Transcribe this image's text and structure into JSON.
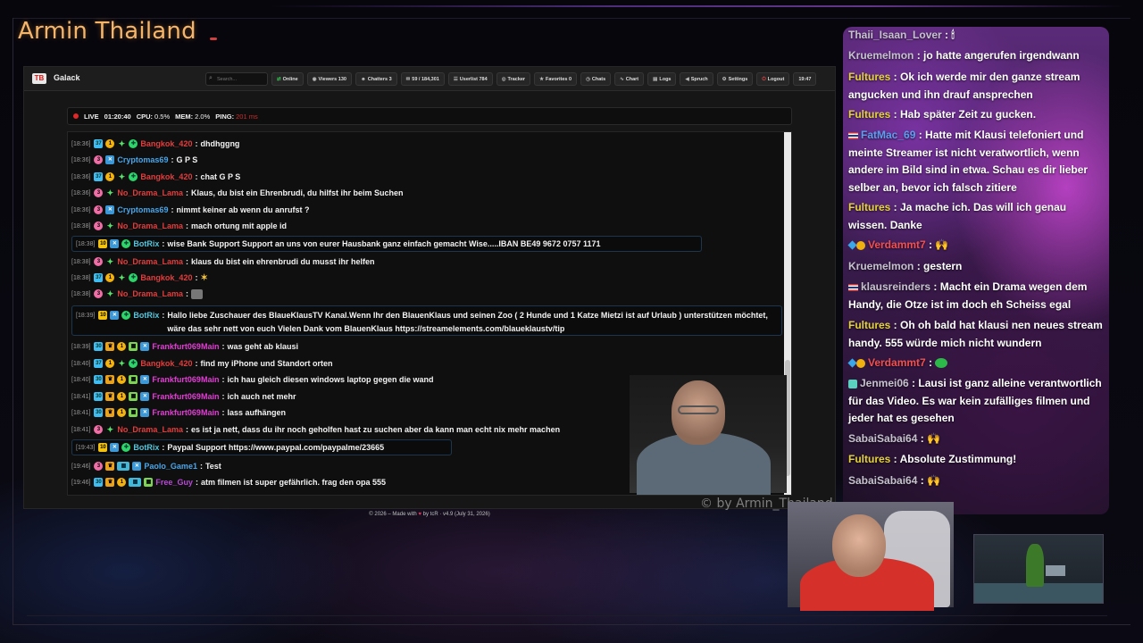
{
  "overlay": {
    "stream_title": "Armin Thailand",
    "watermark": "© by Armin_Thailand"
  },
  "dashboard": {
    "brand": "Galack",
    "logo_text": "TB",
    "search_placeholder": "Search...",
    "nav": [
      {
        "icon": "online-icon",
        "label": "Online"
      },
      {
        "icon": "eye-icon",
        "label": "Viewers 130"
      },
      {
        "icon": "users-icon",
        "label": "Chatters 3"
      },
      {
        "icon": "chat-icon",
        "label": "59 / 184,301"
      },
      {
        "icon": "user-list-icon",
        "label": "Userlist 784"
      },
      {
        "icon": "tracker-icon",
        "label": "Tracker"
      },
      {
        "icon": "star-icon",
        "label": "Favorites 0"
      },
      {
        "icon": "clock-icon",
        "label": "Chats"
      },
      {
        "icon": "chart-icon",
        "label": "Chart"
      },
      {
        "icon": "logs-icon",
        "label": "Logs"
      },
      {
        "icon": "megaphone-icon",
        "label": "Spruch"
      },
      {
        "icon": "gear-icon",
        "label": "Settings"
      },
      {
        "icon": "logout-icon",
        "label": "Logout"
      },
      {
        "icon": "",
        "label": "19:47"
      }
    ],
    "status": {
      "live_label": "LIVE",
      "live_time": "01:20:40",
      "cpu_label": "CPU:",
      "cpu_val": "0.5%",
      "mem_label": "MEM:",
      "mem_val": "2.0%",
      "ping_label": "PING:",
      "ping_val": "201 ms"
    },
    "footer": {
      "pre": "© 2026 – Made with",
      "post": "by tcR · v4.9 (July 31, 2026)"
    }
  },
  "chat": [
    {
      "ts": "[18:36]",
      "user": "Bangkok_420",
      "text": "dhdhggng"
    },
    {
      "ts": "[18:36]",
      "user": "Cryptomas69",
      "text": "G P S"
    },
    {
      "ts": "[18:36]",
      "user": "Bangkok_420",
      "text": "chat G P S"
    },
    {
      "ts": "[18:36]",
      "user": "No_Drama_Lama",
      "text": "Klaus, du bist ein Ehrenbrudi, du hilfst ihr beim Suchen"
    },
    {
      "ts": "[18:36]",
      "user": "Cryptomas69",
      "text": "nimmt keiner ab wenn du anrufst ?"
    },
    {
      "ts": "[18:38]",
      "user": "No_Drama_Lama",
      "text": "mach ortung mit apple id"
    },
    {
      "ts": "[18:38]",
      "user": "BotRix",
      "text": "wise Bank Support Support an uns von eurer Hausbank ganz einfach gemacht Wise.....IBAN BE49 9672 0757 1171"
    },
    {
      "ts": "[18:38]",
      "user": "No_Drama_Lama",
      "text": "klaus du bist ein ehrenbrudi du musst ihr helfen"
    },
    {
      "ts": "[18:38]",
      "user": "Bangkok_420",
      "text": ""
    },
    {
      "ts": "[18:38]",
      "user": "No_Drama_Lama",
      "text": ""
    },
    {
      "ts": "[18:39]",
      "user": "BotRix",
      "text": "Hallo liebe Zuschauer des BlaueKlausTV Kanal.Wenn Ihr den BlauenKlaus und seinen Zoo ( 2 Hunde und 1 Katze Mietzi ist auf Urlaub ) unterstützen möchtet, wäre das sehr nett von euch Vielen Dank vom BlauenKlaus https://streamelements.com/blaueklaustv/tip"
    },
    {
      "ts": "[18:39]",
      "user": "Frankfurt069Main",
      "text": "was geht ab klausi"
    },
    {
      "ts": "[18:40]",
      "user": "Bangkok_420",
      "text": "find my iPhone und Standort orten"
    },
    {
      "ts": "[18:40]",
      "user": "Frankfurt069Main",
      "text": "ich hau gleich diesen windows laptop gegen die wand"
    },
    {
      "ts": "[18:41]",
      "user": "Frankfurt069Main",
      "text": "ich auch net mehr"
    },
    {
      "ts": "[18:41]",
      "user": "Frankfurt069Main",
      "text": "lass aufhängen"
    },
    {
      "ts": "[18:41]",
      "user": "No_Drama_Lama",
      "text": "es ist ja nett, dass du ihr noch geholfen hast zu suchen aber da kann man echt nix mehr machen"
    },
    {
      "ts": "[19:43]",
      "user": "BotRix",
      "text": "Paypal Support https://www.paypal.com/paypalme/23665"
    },
    {
      "ts": "[19:46]",
      "user": "Paolo_Game1",
      "text": "Test"
    },
    {
      "ts": "[19:46]",
      "user": "Free_Guy",
      "text": "atm filmen ist super gefährlich. frag den opa 555"
    }
  ],
  "overlay_chat": [
    {
      "user": "Thaii_Isaan_Lover",
      "text": "🕯"
    },
    {
      "user": "Kruemelmon",
      "text": "jo hatte angerufen irgendwann"
    },
    {
      "user": "Fultures",
      "text": "Ok ich werde mir den ganze stream angucken und ihn drauf ansprechen"
    },
    {
      "user": "Fultures",
      "text": "Hab später Zeit zu gucken."
    },
    {
      "user": "FatMac_69",
      "text": "Hatte mit Klausi telefoniert und meinte Streamer ist nicht veratwortlich, wenn andere im Bild sind in etwa. Schau es dir lieber selber an, bevor ich falsch zitiere"
    },
    {
      "user": "Fultures",
      "text": "Ja mache ich. Das will ich genau wissen. Danke"
    },
    {
      "user": "Verdammt7",
      "text": "🙌"
    },
    {
      "user": "Kruemelmon",
      "text": "gestern"
    },
    {
      "user": "klausreinders",
      "text": "Macht ein Drama wegen dem Handy, die Otze ist im doch eh Scheiss egal"
    },
    {
      "user": "Fultures",
      "text": "Oh oh bald hat klausi nen neues stream handy. 555 würde mich nicht wundern"
    },
    {
      "user": "Verdammt7",
      "text": ""
    },
    {
      "user": "Jenmei06",
      "text": "Lausi ist ganz alleine verantwortlich für das Video. Es war kein zufälliges filmen und jeder hat es gesehen"
    },
    {
      "user": "SabaiSabai64",
      "text": "🙌"
    },
    {
      "user": "Fultures",
      "text": "Absolute Zustimmung!"
    },
    {
      "user": "SabaiSabai64",
      "text": "🙌"
    }
  ]
}
